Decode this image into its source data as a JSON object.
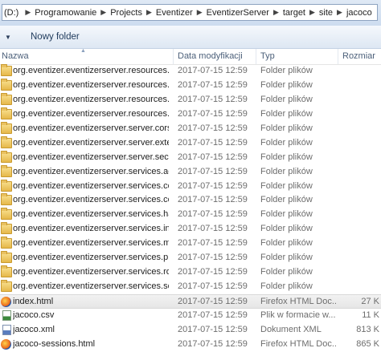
{
  "address": {
    "drive": "(D:)",
    "crumbs": [
      "Programowanie",
      "Projects",
      "Eventizer",
      "EventizerServer",
      "target",
      "site",
      "jacoco"
    ]
  },
  "toolbar": {
    "new_folder": "Nowy folder"
  },
  "columns": {
    "name": "Nazwa",
    "date": "Data modyfikacji",
    "type": "Typ",
    "size": "Rozmiar"
  },
  "files": [
    {
      "name": "org.eventizer.eventizerserver.resources.ac...",
      "date": "2017-07-15 12:59",
      "type": "Folder plików",
      "size": "",
      "icon": "folder-icon"
    },
    {
      "name": "org.eventizer.eventizerserver.resources.pl...",
      "date": "2017-07-15 12:59",
      "type": "Folder plików",
      "size": "",
      "icon": "folder-icon"
    },
    {
      "name": "org.eventizer.eventizerserver.resources.so...",
      "date": "2017-07-15 12:59",
      "type": "Folder plików",
      "size": "",
      "icon": "folder-icon"
    },
    {
      "name": "org.eventizer.eventizerserver.resources.so...",
      "date": "2017-07-15 12:59",
      "type": "Folder plików",
      "size": "",
      "icon": "folder-icon"
    },
    {
      "name": "org.eventizer.eventizerserver.server.cors",
      "date": "2017-07-15 12:59",
      "type": "Folder plików",
      "size": "",
      "icon": "folder-icon"
    },
    {
      "name": "org.eventizer.eventizerserver.server.exten...",
      "date": "2017-07-15 12:59",
      "type": "Folder plików",
      "size": "",
      "icon": "folder-icon"
    },
    {
      "name": "org.eventizer.eventizerserver.server.securi...",
      "date": "2017-07-15 12:59",
      "type": "Folder plików",
      "size": "",
      "icon": "folder-icon"
    },
    {
      "name": "org.eventizer.eventizerserver.services.acc...",
      "date": "2017-07-15 12:59",
      "type": "Folder plików",
      "size": "",
      "icon": "folder-icon"
    },
    {
      "name": "org.eventizer.eventizerserver.services.con...",
      "date": "2017-07-15 12:59",
      "type": "Folder plików",
      "size": "",
      "icon": "folder-icon"
    },
    {
      "name": "org.eventizer.eventizerserver.services.con...",
      "date": "2017-07-15 12:59",
      "type": "Folder plików",
      "size": "",
      "icon": "folder-icon"
    },
    {
      "name": "org.eventizer.eventizerserver.services.has...",
      "date": "2017-07-15 12:59",
      "type": "Folder plików",
      "size": "",
      "icon": "folder-icon"
    },
    {
      "name": "org.eventizer.eventizerserver.services.inte...",
      "date": "2017-07-15 12:59",
      "type": "Folder plików",
      "size": "",
      "icon": "folder-icon"
    },
    {
      "name": "org.eventizer.eventizerserver.services.me...",
      "date": "2017-07-15 12:59",
      "type": "Folder plików",
      "size": "",
      "icon": "folder-icon"
    },
    {
      "name": "org.eventizer.eventizerserver.services.pla...",
      "date": "2017-07-15 12:59",
      "type": "Folder plików",
      "size": "",
      "icon": "folder-icon"
    },
    {
      "name": "org.eventizer.eventizerserver.services.role...",
      "date": "2017-07-15 12:59",
      "type": "Folder plików",
      "size": "",
      "icon": "folder-icon"
    },
    {
      "name": "org.eventizer.eventizerserver.services.soci...",
      "date": "2017-07-15 12:59",
      "type": "Folder plików",
      "size": "",
      "icon": "folder-icon"
    },
    {
      "name": "index.html",
      "date": "2017-07-15 12:59",
      "type": "Firefox HTML Doc...",
      "size": "27 K",
      "icon": "firefox-html-icon",
      "selected": true
    },
    {
      "name": "jacoco.csv",
      "date": "2017-07-15 12:59",
      "type": "Plik w formacie w...",
      "size": "11 K",
      "icon": "csv-file-icon"
    },
    {
      "name": "jacoco.xml",
      "date": "2017-07-15 12:59",
      "type": "Dokument XML",
      "size": "813 K",
      "icon": "xml-file-icon"
    },
    {
      "name": "jacoco-sessions.html",
      "date": "2017-07-15 12:59",
      "type": "Firefox HTML Doc...",
      "size": "865 K",
      "icon": "firefox-html-icon"
    }
  ]
}
